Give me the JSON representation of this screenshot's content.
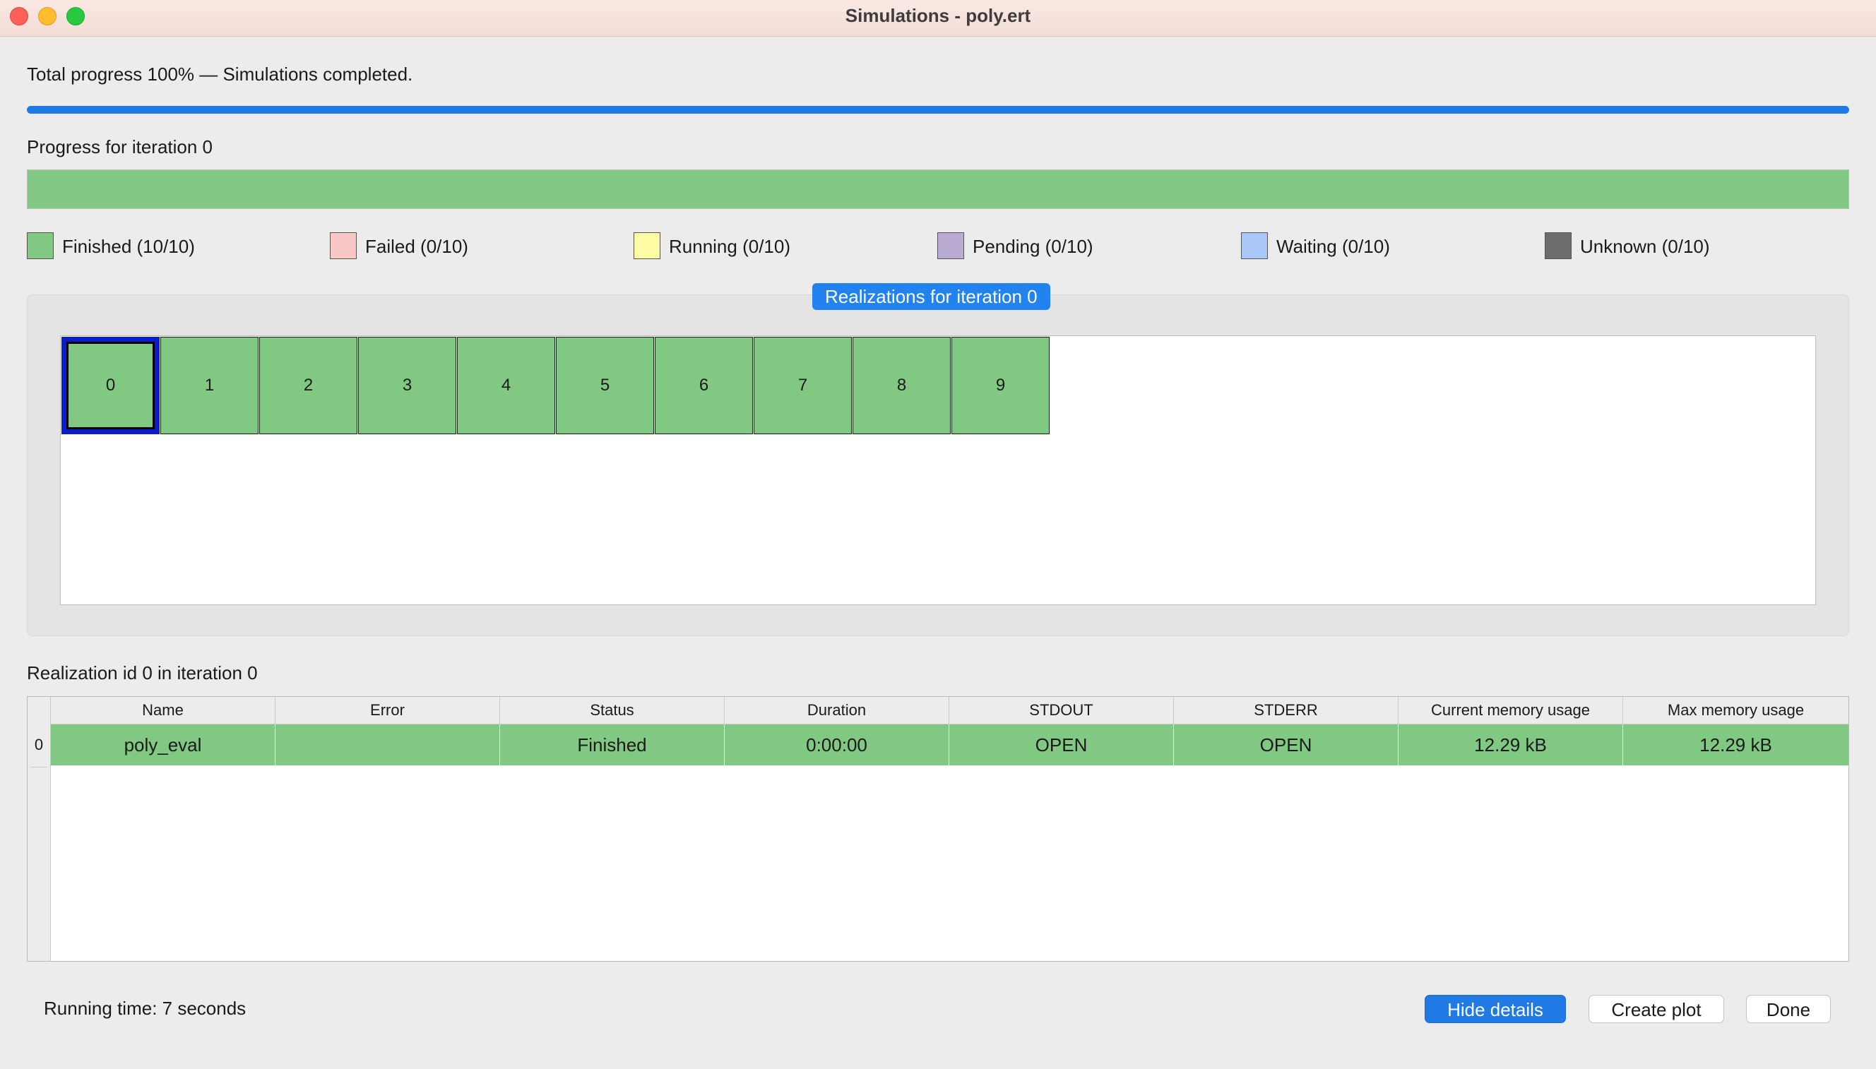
{
  "window": {
    "title": "Simulations - poly.ert"
  },
  "progress": {
    "total_label": "Total progress 100% — Simulations completed.",
    "total_fraction": 1.0,
    "iteration_label": "Progress for iteration 0",
    "iteration_fraction": 1.0
  },
  "legend": [
    {
      "label": "Finished (10/10)",
      "color": "#81c883"
    },
    {
      "label": "Failed (0/10)",
      "color": "#f9c7c6"
    },
    {
      "label": "Running (0/10)",
      "color": "#fdfca4"
    },
    {
      "label": "Pending (0/10)",
      "color": "#b9abd2"
    },
    {
      "label": "Waiting (0/10)",
      "color": "#a9c8f7"
    },
    {
      "label": "Unknown (0/10)",
      "color": "#6c6c6c"
    }
  ],
  "realizations": {
    "title": "Realizations for iteration 0",
    "selected": "0",
    "items": [
      "0",
      "1",
      "2",
      "3",
      "4",
      "5",
      "6",
      "7",
      "8",
      "9"
    ]
  },
  "details": {
    "label": "Realization id 0 in iteration 0",
    "columns": [
      "Name",
      "Error",
      "Status",
      "Duration",
      "STDOUT",
      "STDERR",
      "Current memory usage",
      "Max memory usage"
    ],
    "rows": [
      {
        "index": "0",
        "cells": [
          "poly_eval",
          "",
          "Finished",
          "0:00:00",
          "OPEN",
          "OPEN",
          "12.29 kB",
          "12.29 kB"
        ]
      }
    ]
  },
  "footer": {
    "running_time": "Running time: 7 seconds",
    "hide_details": "Hide details",
    "create_plot": "Create plot",
    "done": "Done"
  }
}
